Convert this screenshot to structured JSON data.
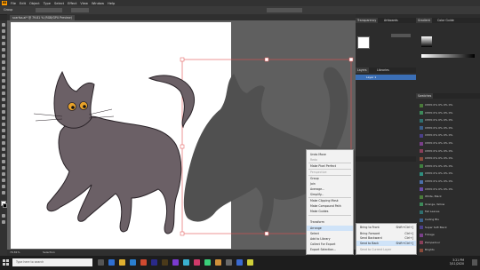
{
  "app": {
    "accent": "#3b6fb6",
    "menus": [
      "File",
      "Edit",
      "Object",
      "Type",
      "Select",
      "Effect",
      "View",
      "Window",
      "Help"
    ],
    "document_tab": "scarfsa.ai* @ 79.81 % (RGB/GPU Preview)",
    "selection_label": "Group"
  },
  "panels": {
    "tabs_top": [
      "Transparency",
      "Artboards"
    ],
    "tabs_right": [
      "Gradient",
      "Color Guide"
    ],
    "layers_tabs": [
      "Layers",
      "Libraries"
    ],
    "layer_name": "Layer 1",
    "swatches_title": "Swatches",
    "swatch_rows": [
      "CMYK 0% 0% 0% 0%",
      "CMYK 0% 0% 0% 0%",
      "CMYK 0% 0% 0% 0%",
      "CMYK 0% 0% 0% 0%",
      "CMYK 0% 0% 0% 0%",
      "CMYK 0% 0% 0% 0%",
      "CMYK 0% 0% 0% 0%",
      "CMYK 0% 0% 0% 0%",
      "CMYK 0% 0% 0% 0%",
      "CMYK 0% 0% 0% 0%",
      "CMYK 0% 0% 0% 0%",
      "CMYK 0% 0% 0% 0%",
      "White, Black",
      "Orange, Yellow",
      "Fall Leaves",
      "Ceiling Blu",
      "Super Soft Black",
      "Foliage",
      "Pompadour",
      "Brights"
    ],
    "swatch_colors": [
      "#4a7a3a",
      "#3d8a5a",
      "#2f6f6f",
      "#3a5f8a",
      "#4b3f8a",
      "#7a3f8a",
      "#8a3f5a",
      "#8a4a3a",
      "#3f7f3f",
      "#2f8f7f",
      "#4a6faa",
      "#6a4aaa"
    ]
  },
  "context_menu": {
    "items": [
      {
        "label": "Undo Move",
        "disabled": false
      },
      {
        "label": "Redo",
        "disabled": true
      },
      {
        "label": "Make Pixel Perfect",
        "disabled": false
      },
      {
        "label": "Perspective",
        "disabled": true
      },
      {
        "label": "Group",
        "disabled": false
      },
      {
        "label": "Join",
        "disabled": false
      },
      {
        "label": "Average...",
        "disabled": false
      },
      {
        "label": "Simplify...",
        "disabled": false
      },
      {
        "label": "Make Clipping Mask",
        "disabled": false
      },
      {
        "label": "Make Compound Path",
        "disabled": false
      },
      {
        "label": "Make Guides",
        "disabled": false
      },
      {
        "label": "Transform",
        "disabled": false
      },
      {
        "label": "Arrange",
        "disabled": false
      },
      {
        "label": "Select",
        "disabled": false
      },
      {
        "label": "Add to Library",
        "disabled": false
      },
      {
        "label": "Collect For Export",
        "disabled": false
      },
      {
        "label": "Export Selection...",
        "disabled": false
      }
    ]
  },
  "submenu": {
    "items": [
      {
        "label": "Bring to Front",
        "shortcut": "Shift+Ctrl+]"
      },
      {
        "label": "Bring Forward",
        "shortcut": "Ctrl+]"
      },
      {
        "label": "Send Backward",
        "shortcut": "Ctrl+["
      },
      {
        "label": "Send to Back",
        "shortcut": "Shift+Ctrl+["
      },
      {
        "label": "Send to Current Layer",
        "shortcut": ""
      }
    ]
  },
  "statusbar": {
    "zoom": "79.81%",
    "tool": "Selection"
  },
  "taskbar": {
    "search_placeholder": "Type here to search",
    "time": "3:21 PM",
    "date": "3/11/2020"
  }
}
